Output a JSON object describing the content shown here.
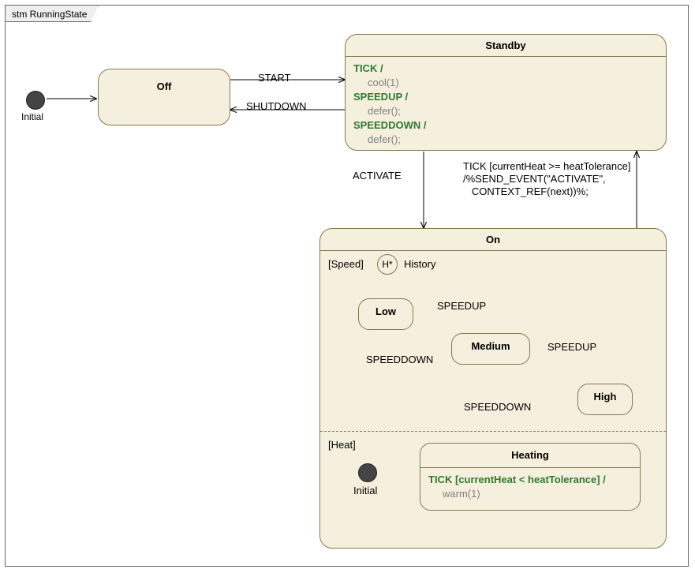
{
  "frame": {
    "tab": "stm RunningState"
  },
  "initial_outer": {
    "label": "Initial"
  },
  "states": {
    "off": {
      "title": "Off"
    },
    "standby": {
      "title": "Standby",
      "lines": [
        {
          "trigger": "TICK /",
          "action": "cool(1)"
        },
        {
          "trigger": "SPEEDUP /",
          "action": "defer();"
        },
        {
          "trigger": "SPEEDDOWN /",
          "action": "defer();"
        }
      ]
    },
    "on": {
      "title": "On",
      "region_speed_label": "[Speed]",
      "history_label": "History",
      "history_glyph": "H*",
      "speed": {
        "low": "Low",
        "medium": "Medium",
        "high": "High"
      },
      "region_heat_label": "[Heat]",
      "heat_initial_label": "Initial",
      "heating": {
        "title": "Heating",
        "trigger": "TICK [currentHeat < heatTolerance] /",
        "action": "warm(1)"
      }
    }
  },
  "edges": {
    "start": "START",
    "shutdown": "SHUTDOWN",
    "activate": "ACTIVATE",
    "tick_guard": "TICK [currentHeat >= heatTolerance]\n/%SEND_EVENT(\"ACTIVATE\",\n   CONTEXT_REF(next))%;",
    "speedup": "SPEEDUP",
    "speeddown": "SPEEDDOWN"
  },
  "chart_data": {
    "type": "state-machine",
    "name": "RunningState",
    "states": [
      {
        "id": "Initial",
        "kind": "initial"
      },
      {
        "id": "Off",
        "kind": "simple"
      },
      {
        "id": "Standby",
        "kind": "simple",
        "internal": [
          {
            "trigger": "TICK",
            "action": "cool(1)"
          },
          {
            "trigger": "SPEEDUP",
            "action": "defer();"
          },
          {
            "trigger": "SPEEDDOWN",
            "action": "defer();"
          }
        ]
      },
      {
        "id": "On",
        "kind": "composite",
        "regions": [
          {
            "name": "Speed",
            "initial": {
              "kind": "deepHistory"
            },
            "states": [
              "Low",
              "Medium",
              "High"
            ],
            "transitions": [
              {
                "from": "History",
                "to": "Low"
              },
              {
                "from": "Low",
                "to": "Medium",
                "trigger": "SPEEDUP"
              },
              {
                "from": "Medium",
                "to": "High",
                "trigger": "SPEEDUP"
              },
              {
                "from": "Medium",
                "to": "Low",
                "trigger": "SPEEDDOWN"
              },
              {
                "from": "High",
                "to": "Medium",
                "trigger": "SPEEDDOWN"
              }
            ]
          },
          {
            "name": "Heat",
            "initial": {
              "kind": "initial"
            },
            "states": [
              {
                "id": "Heating",
                "internal": [
                  {
                    "trigger": "TICK",
                    "guard": "currentHeat < heatTolerance",
                    "action": "warm(1)"
                  }
                ]
              }
            ],
            "transitions": [
              {
                "from": "Initial",
                "to": "Heating"
              }
            ]
          }
        ]
      }
    ],
    "transitions": [
      {
        "from": "Initial",
        "to": "Off"
      },
      {
        "from": "Off",
        "to": "Standby",
        "trigger": "START"
      },
      {
        "from": "Standby",
        "to": "Off",
        "trigger": "SHUTDOWN"
      },
      {
        "from": "Standby",
        "to": "On",
        "trigger": "ACTIVATE"
      },
      {
        "from": "On",
        "to": "Standby",
        "trigger": "TICK",
        "guard": "currentHeat >= heatTolerance",
        "action": "%SEND_EVENT(\"ACTIVATE\", CONTEXT_REF(next))%;"
      }
    ]
  }
}
